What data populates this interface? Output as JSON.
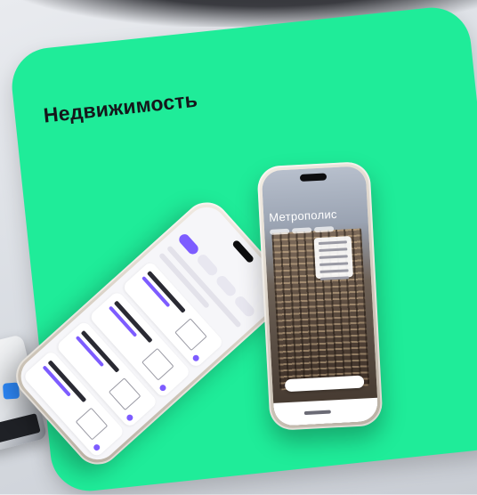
{
  "card": {
    "title": "Недвижимость",
    "color": "#1fec99"
  },
  "phones": {
    "left": {
      "accent": "#7d5cff"
    },
    "right": {
      "title": "Метрополис"
    }
  }
}
